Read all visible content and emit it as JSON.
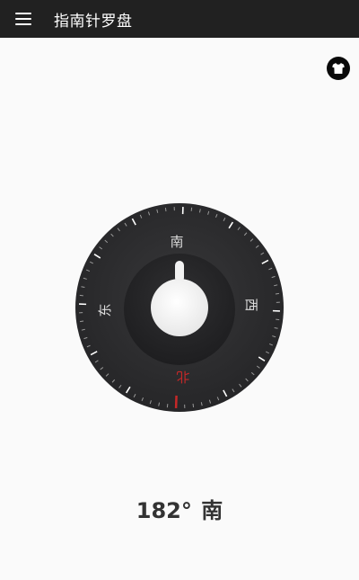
{
  "appbar": {
    "title": "指南针罗盘",
    "menu_icon": "hamburger-menu-icon",
    "background": "#212121"
  },
  "skin_button": {
    "icon": "tshirt-icon"
  },
  "compass": {
    "heading_degrees": 182,
    "labels": {
      "top": "南",
      "left": "东",
      "right": "西",
      "bottom": "北"
    },
    "colors": {
      "dial": "#2b2b2d",
      "inner": "#262628",
      "knob": "#f5f5f5",
      "north": "#c62828",
      "ticks": "#9a9a9a",
      "major_ticks": "#ffffff",
      "labels": "#dddddd"
    }
  },
  "reading": {
    "degrees": "182°",
    "direction": "南"
  }
}
